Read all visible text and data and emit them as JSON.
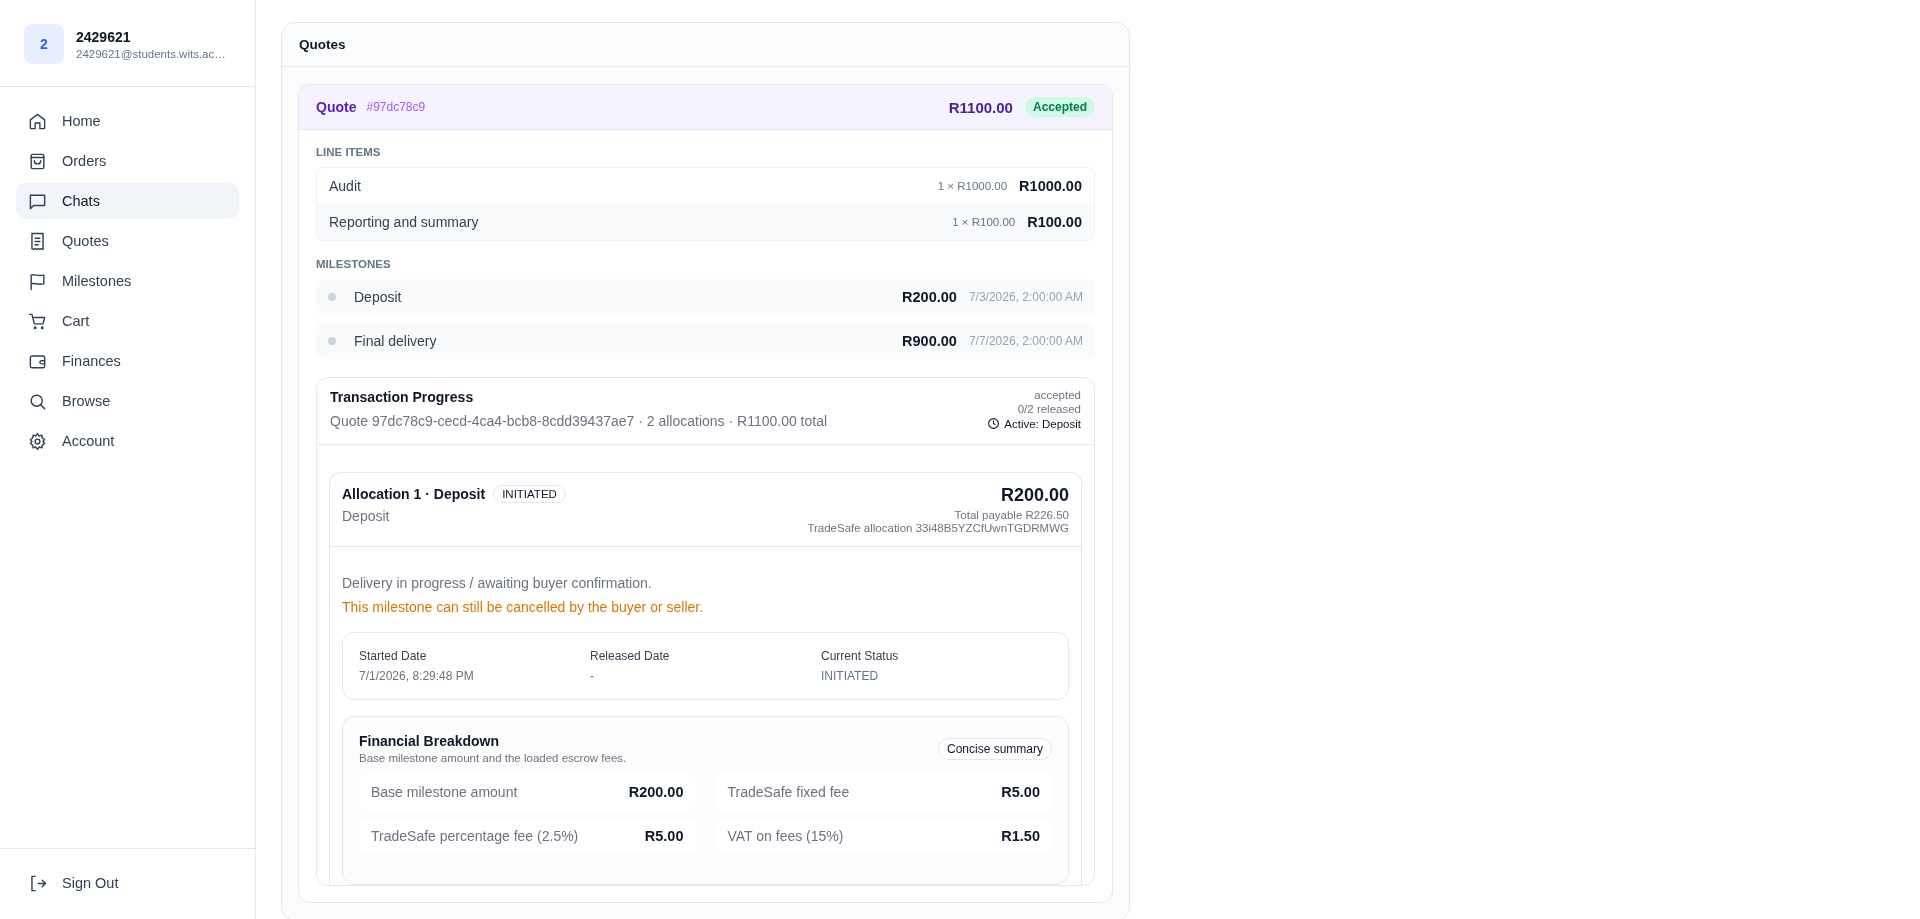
{
  "user": {
    "avatar": "2",
    "name": "2429621",
    "email": "2429621@students.wits.ac…"
  },
  "nav": [
    {
      "label": "Home",
      "kind": "home",
      "selected": false
    },
    {
      "label": "Orders",
      "kind": "bag",
      "selected": false
    },
    {
      "label": "Chats",
      "kind": "chat",
      "selected": true
    },
    {
      "label": "Quotes",
      "kind": "receipt",
      "selected": false
    },
    {
      "label": "Milestones",
      "kind": "flag",
      "selected": false
    },
    {
      "label": "Cart",
      "kind": "cart",
      "selected": false
    },
    {
      "label": "Finances",
      "kind": "wallet",
      "selected": false
    },
    {
      "label": "Browse",
      "kind": "search",
      "selected": false
    },
    {
      "label": "Account",
      "kind": "gear",
      "selected": false
    }
  ],
  "sign_out": "Sign Out",
  "panel_title": "Quotes",
  "quote": {
    "label": "Quote",
    "id": "#97dc78c9",
    "total": "R1100.00",
    "status": "Accepted",
    "line_items_label": "LINE ITEMS",
    "line_items": [
      {
        "name": "Audit",
        "qty": "1 × R1000.00",
        "amount": "R1000.00"
      },
      {
        "name": "Reporting and summary",
        "qty": "1 × R100.00",
        "amount": "R100.00"
      }
    ],
    "milestones_label": "MILESTONES",
    "milestones": [
      {
        "name": "Deposit",
        "amount": "R200.00",
        "date": "7/3/2026, 2:00:00 AM"
      },
      {
        "name": "Final delivery",
        "amount": "R900.00",
        "date": "7/7/2026, 2:00:00 AM"
      }
    ]
  },
  "progress": {
    "title": "Transaction Progress",
    "subtitle": "Quote 97dc78c9-cecd-4ca4-bcb8-8cdd39437ae7 · 2 allocations · R1100.00 total",
    "state": "accepted",
    "released": "0/2 released",
    "active": "Active: Deposit",
    "allocation": {
      "title": "Allocation 1 · Deposit",
      "badge": "INITIATED",
      "subtitle": "Deposit",
      "amount": "R200.00",
      "payable": "Total payable R226.50",
      "reference": "TradeSafe allocation 33i48B5YZCfUwnTGDRMWG",
      "message": "Delivery in progress / awaiting buyer confirmation.",
      "warning": "This milestone can still be cancelled by the buyer or seller.",
      "details": [
        {
          "label": "Started Date",
          "value": "7/1/2026, 8:29:48 PM"
        },
        {
          "label": "Released Date",
          "value": "-"
        },
        {
          "label": "Current Status",
          "value": "INITIATED",
          "kind": "status"
        }
      ],
      "breakdown": {
        "title": "Financial Breakdown",
        "subtitle": "Base milestone amount and the loaded escrow fees.",
        "button": "Concise summary",
        "rows": [
          {
            "label": "Base milestone amount",
            "value": "R200.00"
          },
          {
            "label": "TradeSafe fixed fee",
            "value": "R5.00"
          },
          {
            "label": "TradeSafe percentage fee (2.5%)",
            "value": "R5.00"
          },
          {
            "label": "VAT on fees (15%)",
            "value": "R1.50"
          }
        ]
      }
    }
  }
}
